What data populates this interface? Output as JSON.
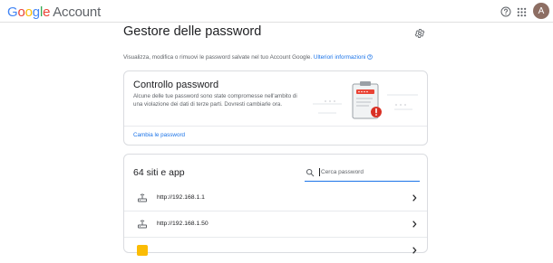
{
  "header": {
    "logo_google": "Google",
    "logo_account": "Account",
    "avatar_letter": "A"
  },
  "page": {
    "title": "Gestore delle password",
    "subtitle": "Visualizza, modifica o rimuovi le password salvate nel tuo Account Google.",
    "subtitle_link": "Ulteriori informazioni"
  },
  "check_card": {
    "title": "Controllo password",
    "description": "Alcune delle tue password sono state compromesse nell'ambito di una violazione dei dati di terze parti. Dovresti cambiarle ora.",
    "action": "Cambia le password"
  },
  "sites_card": {
    "count_label": "64 siti e app",
    "search_placeholder": "Cerca password",
    "rows": [
      {
        "site": "http://192.168.1.1",
        "icon": "router-icon"
      },
      {
        "site": "http://192.168.1.50",
        "icon": "router-icon"
      },
      {
        "site": "",
        "icon": "site-favicon"
      }
    ]
  },
  "colors": {
    "accent": "#1a73e8",
    "warning": "#d93025",
    "divider": "#e0e0e0"
  }
}
